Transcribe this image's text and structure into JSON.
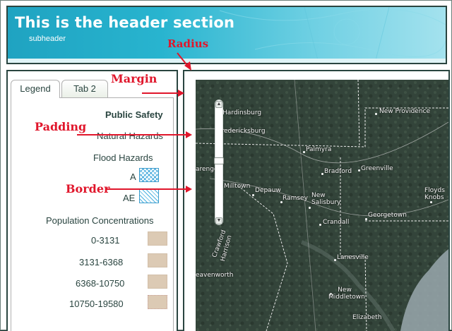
{
  "header": {
    "title": "This is the header section",
    "subtitle": "subheader"
  },
  "left_panel": {
    "tabs": [
      {
        "label": "Legend"
      },
      {
        "label": "Tab 2"
      }
    ],
    "legend": {
      "group_public_safety": "Public Safety",
      "group_natural_hazards": "Natural Hazards",
      "flood_title": "Flood Hazards",
      "flood_items": [
        {
          "label": "A"
        },
        {
          "label": "AE"
        }
      ],
      "population_title": "Population Concentrations",
      "population_items": [
        {
          "label": "0-3131"
        },
        {
          "label": "3131-6368"
        },
        {
          "label": "6368-10750"
        },
        {
          "label": "10750-19580"
        }
      ]
    }
  },
  "map": {
    "towns": [
      "Hardinsburg",
      "New Providence",
      "Fredericksburg",
      "Palmyra",
      "Greenville",
      "Bradford",
      "arengo",
      "Milltown",
      "Depauw",
      "Ramsey",
      "New Salisbury",
      "Floyds Knobs",
      "Georgetown",
      "Crandall",
      "Crawford",
      "Harrison",
      "Lanesville",
      "eavenworth",
      "New Middletown",
      "Elizabeth"
    ],
    "zoom_in_symbol": "▲",
    "zoom_out_symbol": "▼"
  },
  "annotations": {
    "radius": "Radius",
    "margin": "Margin",
    "padding": "Padding",
    "border": "Border"
  },
  "colors": {
    "annotation": "#e0162b",
    "header_teal": "#28b4cf",
    "border_dark": "#2a4540",
    "population_swatch": "#dccab4",
    "flood_hatch": "#48b0e0"
  }
}
